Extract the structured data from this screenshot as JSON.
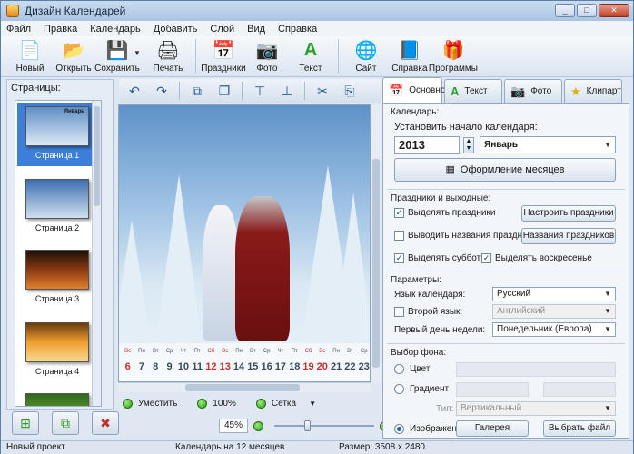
{
  "window": {
    "title": "Дизайн Календарей",
    "min": "_",
    "max": "□",
    "close": "✕"
  },
  "menu": [
    "Файл",
    "Правка",
    "Календарь",
    "Добавить",
    "Слой",
    "Вид",
    "Справка"
  ],
  "toolbar": {
    "new": "Новый",
    "open": "Открыть",
    "save": "Сохранить",
    "print": "Печать",
    "holidays": "Праздники",
    "photo": "Фото",
    "text": "Текст",
    "site": "Сайт",
    "help": "Справка",
    "programs": "Программы"
  },
  "pages": {
    "title": "Страницы:",
    "items": [
      "Страница 1",
      "Страница 2",
      "Страница 3",
      "Страница 4"
    ],
    "selected_thumb_caption": "Январь"
  },
  "canvas": {
    "weekdays": [
      "Вс",
      "Пн",
      "Вт",
      "Ср",
      "Чт",
      "Пт",
      "Сб",
      "Вс",
      "Пн",
      "Вт",
      "Ср",
      "Чт",
      "Пт",
      "Сб",
      "Вс",
      "Пн",
      "Вт",
      "Ср"
    ],
    "days": [
      "6",
      "7",
      "8",
      "9",
      "10",
      "11",
      "12",
      "13",
      "14",
      "15",
      "16",
      "17",
      "18",
      "19",
      "20",
      "21",
      "22",
      "23"
    ],
    "options": {
      "fit": "Уместить",
      "actual": "100%",
      "grid": "Сетка"
    },
    "zoom": "45%",
    "zoom_fraction": 0.32
  },
  "tabs": [
    "Основное",
    "Текст",
    "Фото",
    "Клипарт"
  ],
  "main": {
    "calendar_section": "Календарь:",
    "start_label": "Установить начало календаря:",
    "year": "2013",
    "month": "Январь",
    "months_design_button": "Оформление месяцев",
    "holidays_section": "Праздники и выходные:",
    "highlight_holidays": "Выделять праздники",
    "configure_holidays_button": "Настроить праздники",
    "show_holiday_names": "Выводить названия праздников",
    "holiday_names_button": "Названия праздников",
    "highlight_saturday": "Выделять субботу",
    "highlight_sunday": "Выделять воскресенье",
    "params_section": "Параметры:",
    "language_label": "Язык календаря:",
    "language_value": "Русский",
    "second_language_label": "Второй язык:",
    "second_language_value": "Английский",
    "first_day_label": "Первый день недели:",
    "first_day_value": "Понедельник (Европа)",
    "background_section": "Выбор фона:",
    "bg_color": "Цвет",
    "bg_gradient": "Градиент",
    "gradient_type_label": "Тип:",
    "gradient_type_value": "Вертикальный",
    "bg_image": "Изображение",
    "gallery_button": "Галерея",
    "choose_file_button": "Выбрать файл"
  },
  "status": {
    "project": "Новый проект",
    "calendar": "Календарь на 12 месяцев",
    "size": "Размер: 3508 x 2480"
  },
  "colors": {
    "accent": "#3c7fd8",
    "weekend": "#c4302a"
  }
}
